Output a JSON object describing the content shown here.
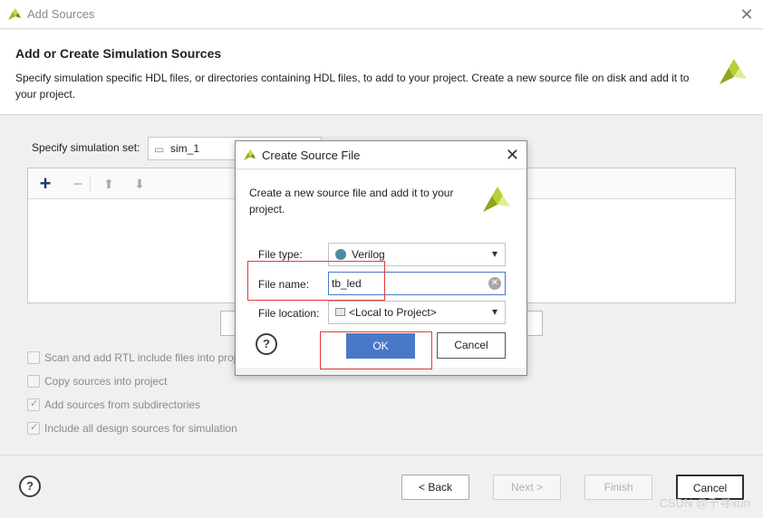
{
  "window": {
    "title": "Add Sources",
    "close_glyph": "✕"
  },
  "header": {
    "title": "Add or Create Simulation Sources",
    "description": "Specify simulation specific HDL files, or directories containing HDL files, to add to your project. Create a new source file on disk and add it to your project."
  },
  "simulation_set": {
    "label": "Specify simulation set:",
    "value": "sim_1",
    "icon": "folder-icon"
  },
  "toolbar": {
    "add_icon": "plus-icon",
    "remove_icon": "minus-icon",
    "up_icon": "arrow-up-icon",
    "down_icon": "arrow-down-icon"
  },
  "options": [
    {
      "label": "Scan and add RTL include files into project",
      "checked": false
    },
    {
      "label": "Copy sources into project",
      "checked": false
    },
    {
      "label": "Add sources from subdirectories",
      "checked": true
    },
    {
      "label": "Include all design sources for simulation",
      "checked": true
    }
  ],
  "footer": {
    "help": "?",
    "back": "< Back",
    "next": "Next >",
    "finish": "Finish",
    "cancel": "Cancel"
  },
  "dialog": {
    "title": "Create Source File",
    "description": "Create a new source file and add it to your project.",
    "file_type": {
      "label": "File type:",
      "value": "Verilog",
      "color": "#4a8aa6"
    },
    "file_name": {
      "label": "File name:",
      "value": "tb_led"
    },
    "file_location": {
      "label": "File location:",
      "value": "<Local to Project>"
    },
    "help": "?",
    "ok": "OK",
    "cancel": "Cancel"
  },
  "watermark": "CSDN @千寻xun",
  "colors": {
    "accent": "#4a78c8",
    "highlight": "#e53a3a",
    "logo_green": "#8aa81e"
  }
}
